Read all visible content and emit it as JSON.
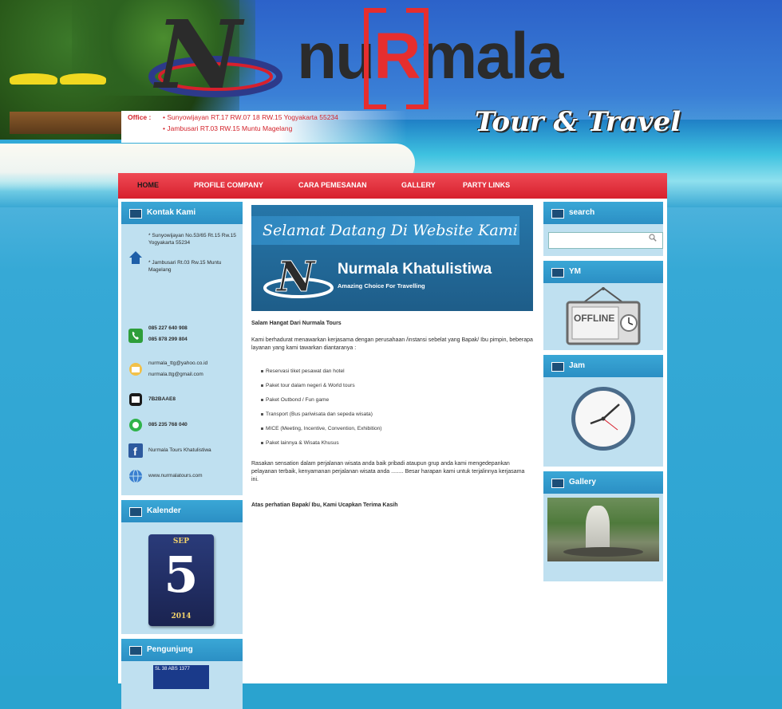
{
  "header": {
    "brand_prefix": "nu",
    "brand_r": "R",
    "brand_suffix": "mala",
    "tagline": "Tour & Travel",
    "office_label": "Office :",
    "office_line1": "• Sunyowijayan RT.17 RW.07 18 RW.15 Yogyakarta 55234",
    "office_line2": "• Jambusari RT.03 RW.15 Muntu Magelang"
  },
  "nav": {
    "items": [
      "HOME",
      "PROFILE COMPANY",
      "CARA PEMESANAN",
      "GALLERY",
      "PARTY LINKS"
    ]
  },
  "sidebar_left": {
    "contact_title": "Kontak Kami",
    "address1": "* Sunyowijayan No.53/65 Rt.15 Rw.15 Yogyakarta 55234",
    "address2": "* Jambusari Rt.03 Rw.15 Muntu Magelang",
    "phone1": "085 227 640 908",
    "phone2": "085 878 299 804",
    "email1": "nurmala_ttg@yahoo.co.id",
    "email2": "nurmala.ttg@gmail.com",
    "bbm": "7B2BAAE8",
    "whatsapp": "085 235 768 040",
    "facebook": "Nurmala Tours Khatulistiwa",
    "website": "www.nurmalatours.com",
    "calendar_title": "Kalender",
    "cal_month": "SEP",
    "cal_day": "5",
    "cal_year": "2014",
    "visitor_title": "Pengunjung",
    "visitor_counter": "SL 38 ABS 1377"
  },
  "main": {
    "banner_welcome": "Selamat Datang Di Website Kami",
    "banner_name": "Nurmala Khatulistiwa",
    "banner_sub": "Amazing Choice For Travelling",
    "greeting": "Salam Hangat Dari Nurmala Tours",
    "intro": "Kami berhadurat menawarkan kerjasama dengan perusahaan /instansi sebelat yang Bapak/ Ibu pimpin, beberapa layanan yang kami tawarkan diantaranya :",
    "services": [
      "Reservasi tiket pesawat dan hotel",
      "Paket tour dalam negeri & World tours",
      "Paket Outbond / Fun game",
      "Transport (Bus pariwisata dan sepeda wisata)",
      "MICE (Meeting, Incentive, Convention, Exhibition)",
      "Paket lainnya & Wisata Khusus"
    ],
    "closing": "Rasakan sensation dalam perjalanan wisata anda baik pribadi ataupun grup anda kami mengedepankan pelayanan terbaik, kenyamanan perjalanan wisata anda ........ Besar harapan kami untuk terjalinnya kerjasama ini.",
    "thanks": "Atas perhatian Bapak/ Ibu, Kami Ucapkan Terima Kasih"
  },
  "sidebar_right": {
    "search_title": "search",
    "search_placeholder": "",
    "ym_title": "YM",
    "ym_status": "OFFLINE",
    "clock_title": "Jam",
    "gallery_title": "Gallery"
  }
}
